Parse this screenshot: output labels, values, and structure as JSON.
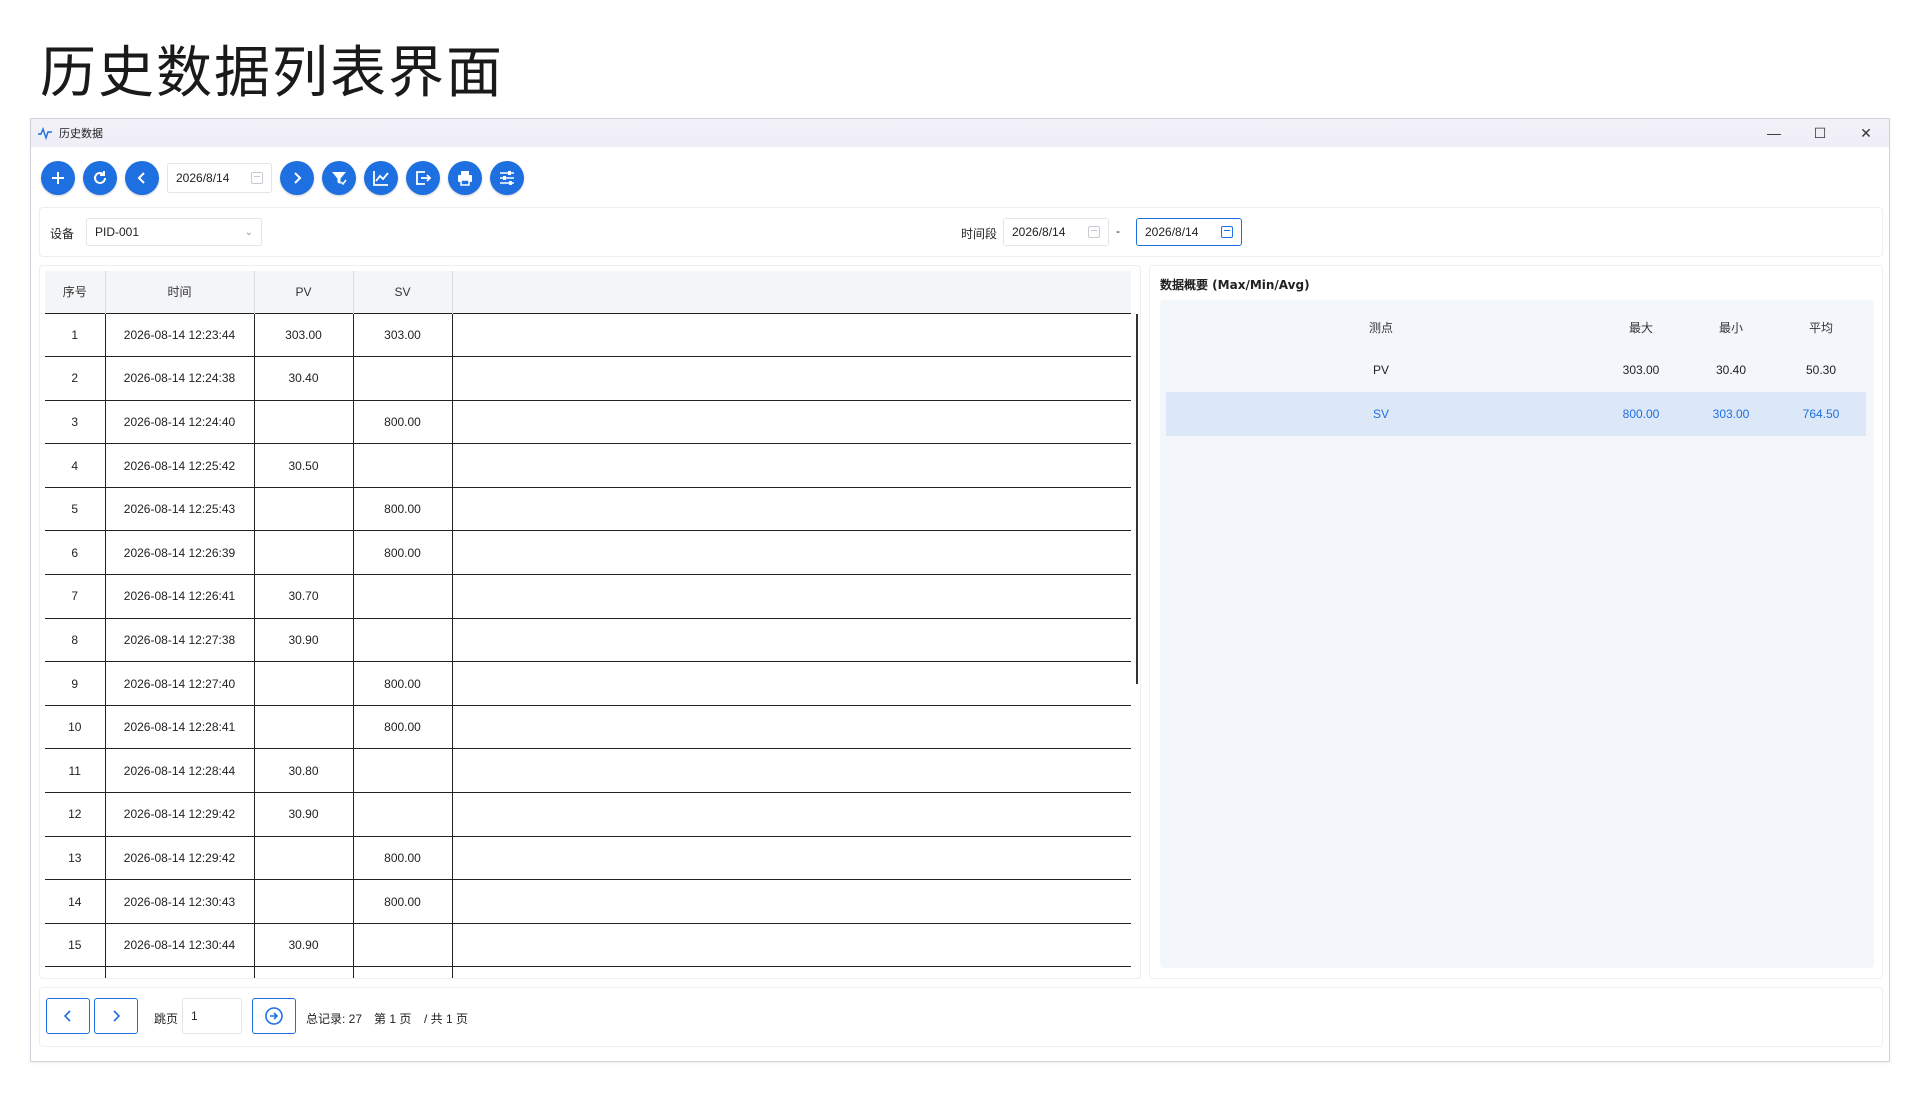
{
  "page_heading": "历史数据列表界面",
  "window": {
    "title": "历史数据",
    "controls": {
      "minimize": "—",
      "maximize": "☐",
      "close": "✕"
    }
  },
  "toolbar": {
    "date": "2026/8/14",
    "buttons": [
      "add-icon",
      "refresh-icon",
      "prev-day-icon",
      "next-day-icon",
      "filter-icon",
      "chart-icon",
      "export-icon",
      "print-icon",
      "settings-icon"
    ]
  },
  "filters": {
    "device_label": "设备",
    "device_value": "PID-001",
    "period_label": "时间段",
    "period_start": "2026/8/14",
    "period_dash": "-",
    "period_end": "2026/8/14"
  },
  "table": {
    "headers": [
      "序号",
      "时间",
      "PV",
      "SV"
    ],
    "rows": [
      [
        "1",
        "2026-08-14 12:23:44",
        "303.00",
        "303.00"
      ],
      [
        "2",
        "2026-08-14 12:24:38",
        "30.40",
        ""
      ],
      [
        "3",
        "2026-08-14 12:24:40",
        "",
        "800.00"
      ],
      [
        "4",
        "2026-08-14 12:25:42",
        "30.50",
        ""
      ],
      [
        "5",
        "2026-08-14 12:25:43",
        "",
        "800.00"
      ],
      [
        "6",
        "2026-08-14 12:26:39",
        "",
        "800.00"
      ],
      [
        "7",
        "2026-08-14 12:26:41",
        "30.70",
        ""
      ],
      [
        "8",
        "2026-08-14 12:27:38",
        "30.90",
        ""
      ],
      [
        "9",
        "2026-08-14 12:27:40",
        "",
        "800.00"
      ],
      [
        "10",
        "2026-08-14 12:28:41",
        "",
        "800.00"
      ],
      [
        "11",
        "2026-08-14 12:28:44",
        "30.80",
        ""
      ],
      [
        "12",
        "2026-08-14 12:29:42",
        "30.90",
        ""
      ],
      [
        "13",
        "2026-08-14 12:29:42",
        "",
        "800.00"
      ],
      [
        "14",
        "2026-08-14 12:30:43",
        "",
        "800.00"
      ],
      [
        "15",
        "2026-08-14 12:30:44",
        "30.90",
        ""
      ]
    ]
  },
  "summary": {
    "title": "数据概要 (Max/Min/Avg)",
    "headers": [
      "测点",
      "最大",
      "最小",
      "平均"
    ],
    "rows": [
      [
        "PV",
        "303.00",
        "30.40",
        "50.30"
      ],
      [
        "SV",
        "800.00",
        "303.00",
        "764.50"
      ]
    ],
    "selected_row": 1
  },
  "pager": {
    "jump_label": "跳页",
    "jump_value": "1",
    "total_label": "总记录: 27",
    "page_label": "第 1 页",
    "pages_label": "/ 共 1 页"
  },
  "colors": {
    "accent": "#1e6fe0",
    "selected_row_bg": "#dce8f8",
    "summary_bg": "#f3f6fb"
  }
}
